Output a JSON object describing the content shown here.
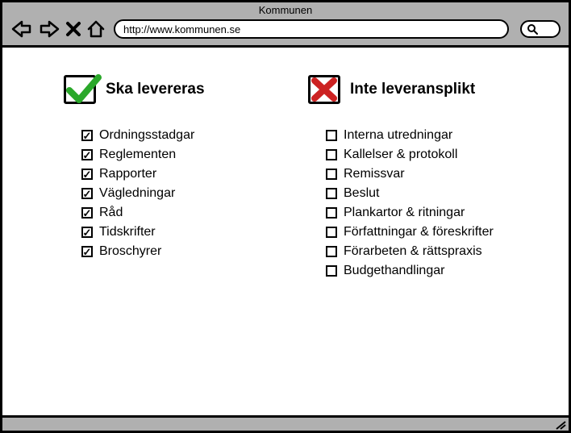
{
  "window": {
    "title": "Kommunen",
    "url": "http://www.kommunen.se"
  },
  "left": {
    "title": "Ska levereras",
    "items": [
      "Ordningsstadgar",
      "Reglementen",
      "Rapporter",
      "Vägledningar",
      "Råd",
      "Tidskrifter",
      "Broschyrer"
    ]
  },
  "right": {
    "title": "Inte leveransplikt",
    "items": [
      "Interna utredningar",
      "Kallelser & protokoll",
      "Remissvar",
      "Beslut",
      "Plankartor & ritningar",
      "Författningar & föreskrifter",
      "Förarbeten & rättspraxis",
      "Budgethandlingar"
    ]
  },
  "colors": {
    "check": "#2aa82a",
    "cross": "#c22"
  }
}
